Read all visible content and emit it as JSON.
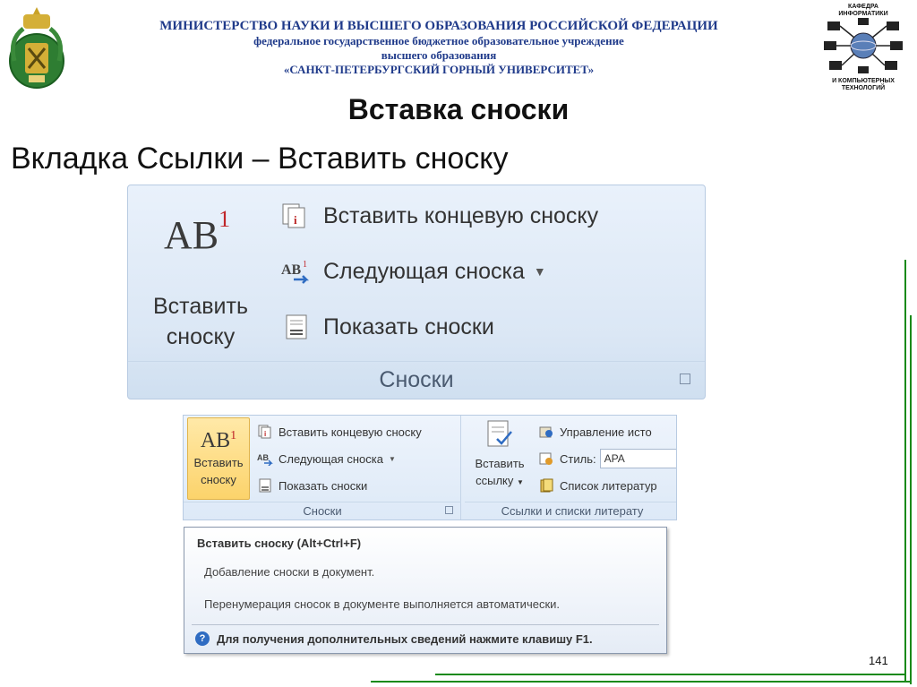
{
  "header": {
    "ministry": "МИНИСТЕРСТВО НАУКИ И ВЫСШЕГО ОБРАЗОВАНИЯ РОССИЙСКОЙ ФЕДЕРАЦИИ",
    "institution_type": "федеральное государственное бюджетное образовательное учреждение",
    "education_level": "высшего образования",
    "university": "«САНКТ-ПЕТЕРБУРГСКИЙ ГОРНЫЙ УНИВЕРСИТЕТ»"
  },
  "dept_logo": {
    "line1": "КАФЕДРА",
    "line2": "ИНФОРМАТИКИ",
    "line3": "И КОМПЬЮТЕРНЫХ",
    "line4": "ТЕХНОЛОГИЙ"
  },
  "slide": {
    "title": "Вставка сноски",
    "subtitle": "Вкладка Ссылки – Вставить сноску",
    "page_number": "141"
  },
  "ribbon_large": {
    "ab_text": "AB",
    "ab_sup": "1",
    "insert_label_line1": "Вставить",
    "insert_label_line2": "сноску",
    "insert_endnote": "Вставить концевую сноску",
    "next_footnote": "Следующая сноска",
    "show_notes": "Показать сноски",
    "group_label": "Сноски"
  },
  "ribbon_small": {
    "ab_text": "AB",
    "ab_sup": "1",
    "insert_label_line1": "Вставить",
    "insert_label_line2": "сноску",
    "insert_endnote": "Вставить концевую сноску",
    "next_footnote": "Следующая сноска",
    "show_notes": "Показать сноски",
    "footnotes_group": "Сноски",
    "citation_label_line1": "Вставить",
    "citation_label_line2": "ссылку",
    "manage_sources": "Управление исто",
    "style_label": "Стиль:",
    "style_value": "APA",
    "bibliography": "Список литератур",
    "citations_group": "Ссылки и списки литерату"
  },
  "tooltip": {
    "title": "Вставить сноску (Alt+Ctrl+F)",
    "line1": "Добавление сноски в документ.",
    "line2": "Перенумерация сносок в документе выполняется автоматически.",
    "help": "Для получения дополнительных сведений нажмите клавишу F1."
  },
  "colors": {
    "header_text": "#1f3a8a",
    "frame": "#1a8a1a",
    "ribbon_bg": "#dbe7f5",
    "highlight": "#fcd36b"
  },
  "icons": [
    "crest-icon",
    "dept-network-icon",
    "endnote-icon",
    "next-footnote-icon",
    "show-notes-icon",
    "dialog-launcher-icon",
    "citation-icon",
    "manage-sources-icon",
    "style-icon",
    "bibliography-icon",
    "help-icon"
  ]
}
